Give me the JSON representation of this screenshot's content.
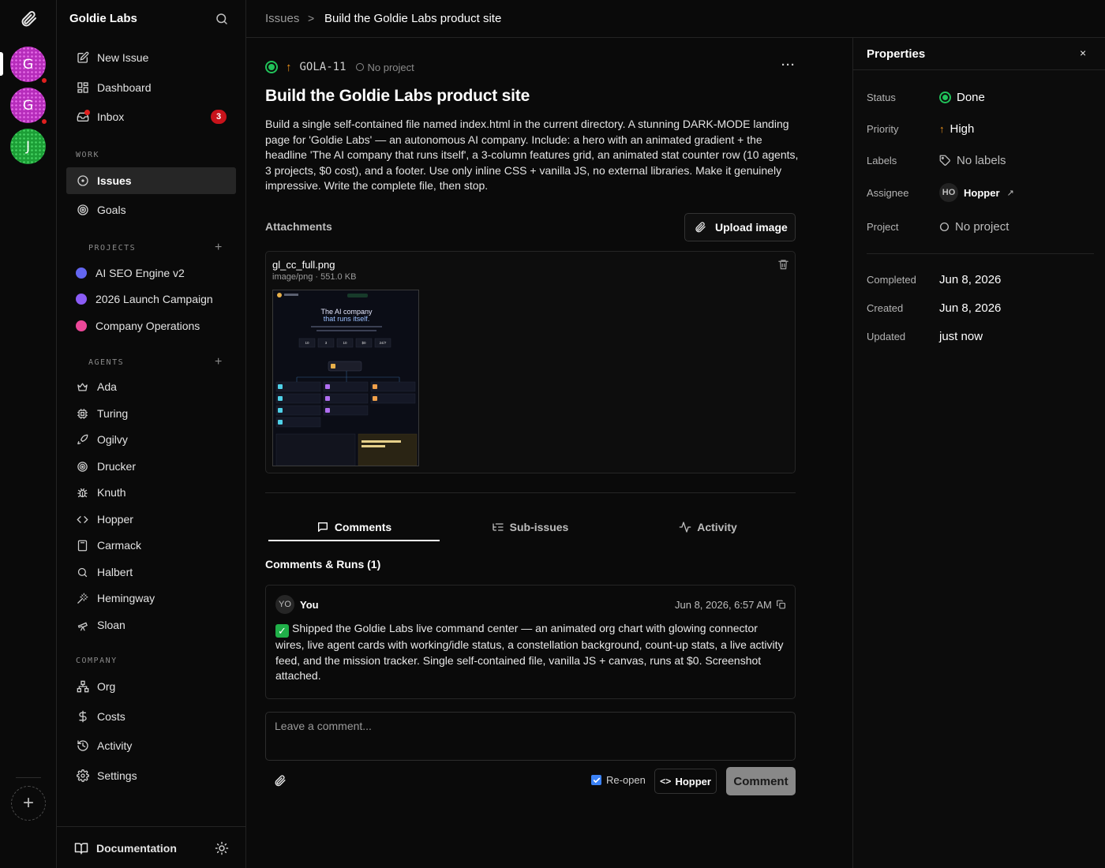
{
  "rail": {
    "companies": [
      {
        "initial": "G",
        "color": "#b62dbb",
        "alert": true
      },
      {
        "initial": "G",
        "color": "#b62dbb",
        "alert": true
      },
      {
        "initial": "J",
        "color": "#1c9e36",
        "alert": false
      }
    ],
    "add_label": "+"
  },
  "sidebar": {
    "org_name": "Goldie Labs",
    "top_items": [
      {
        "label": "New Issue",
        "icon": "edit-icon"
      },
      {
        "label": "Dashboard",
        "icon": "grid-icon"
      },
      {
        "label": "Inbox",
        "icon": "inbox-icon",
        "badge": "3"
      }
    ],
    "work_label": "WORK",
    "work_items": [
      {
        "label": "Issues",
        "icon": "circle-dot-icon",
        "active": true
      },
      {
        "label": "Goals",
        "icon": "target-icon"
      }
    ],
    "projects_label": "PROJECTS",
    "projects": [
      {
        "label": "AI SEO Engine v2",
        "color": "#6366f1"
      },
      {
        "label": "2026 Launch Campaign",
        "color": "#8b5cf6"
      },
      {
        "label": "Company Operations",
        "color": "#ec4899"
      }
    ],
    "agents_label": "AGENTS",
    "agents": [
      {
        "label": "Ada",
        "icon": "crown-icon"
      },
      {
        "label": "Turing",
        "icon": "cpu-icon"
      },
      {
        "label": "Ogilvy",
        "icon": "rocket-icon"
      },
      {
        "label": "Drucker",
        "icon": "target-icon"
      },
      {
        "label": "Knuth",
        "icon": "bug-icon"
      },
      {
        "label": "Hopper",
        "icon": "code-icon"
      },
      {
        "label": "Carmack",
        "icon": "calculator-icon"
      },
      {
        "label": "Halbert",
        "icon": "search-icon"
      },
      {
        "label": "Hemingway",
        "icon": "wand-icon"
      },
      {
        "label": "Sloan",
        "icon": "telescope-icon"
      }
    ],
    "company_label": "COMPANY",
    "company_items": [
      {
        "label": "Org",
        "icon": "org-icon"
      },
      {
        "label": "Costs",
        "icon": "dollar-icon"
      },
      {
        "label": "Activity",
        "icon": "history-icon"
      },
      {
        "label": "Settings",
        "icon": "gear-icon"
      }
    ],
    "footer_label": "Documentation"
  },
  "breadcrumb": {
    "parent": "Issues",
    "separator": ">",
    "current": "Build the Goldie Labs product site"
  },
  "issue": {
    "status_color": "#21c35a",
    "priority_symbol": "↑",
    "id": "GOLA-11",
    "project": "No project",
    "more": "···",
    "title": "Build the Goldie Labs product site",
    "description": "Build a single self-contained file named index.html in the current directory. A stunning DARK-MODE landing page for 'Goldie Labs' — an autonomous AI company. Include: a hero with an animated gradient + the headline 'The AI company that runs itself', a 3-column features grid, an animated stat counter row (10 agents, 3 projects, $0 cost), and a footer. Use only inline CSS + vanilla JS, no external libraries. Make it genuinely impressive. Write the complete file, then stop."
  },
  "attachments": {
    "label": "Attachments",
    "upload_label": "Upload image",
    "file": {
      "name": "gl_cc_full.png",
      "meta": "image/png · 551.0 KB",
      "preview_headline_1": "The AI company",
      "preview_headline_2": "that runs itself.",
      "preview_stats": [
        "10",
        "3",
        "10",
        "$0",
        "24/7"
      ]
    }
  },
  "tabs": [
    {
      "label": "Comments",
      "icon": "message-icon",
      "active": true
    },
    {
      "label": "Sub-issues",
      "icon": "list-tree-icon",
      "active": false
    },
    {
      "label": "Activity",
      "icon": "pulse-icon",
      "active": false
    }
  ],
  "comments": {
    "heading": "Comments & Runs (1)",
    "items": [
      {
        "initials": "YO",
        "author": "You",
        "timestamp": "Jun 8, 2026, 6:57 AM",
        "emoji": "✓",
        "body": "Shipped the Goldie Labs live command center — an animated org chart with glowing connector wires, live agent cards with working/idle status, a constellation background, count-up stats, a live activity feed, and the mission tracker. Single self-contained file, vanilla JS + canvas, runs at $0. Screenshot attached."
      }
    ],
    "input_placeholder": "Leave a comment...",
    "reopen_label": "Re-open",
    "reopen_checked": true,
    "assignee_button": "Hopper",
    "submit_label": "Comment"
  },
  "properties": {
    "title": "Properties",
    "close": "×",
    "status_label": "Status",
    "status_value": "Done",
    "priority_label": "Priority",
    "priority_value": "High",
    "labels_label": "Labels",
    "labels_value": "No labels",
    "assignee_label": "Assignee",
    "assignee_initials": "HO",
    "assignee_value": "Hopper",
    "assignee_link": "↗",
    "project_label": "Project",
    "project_value": "No project",
    "completed_label": "Completed",
    "completed_value": "Jun 8, 2026",
    "created_label": "Created",
    "created_value": "Jun 8, 2026",
    "updated_label": "Updated",
    "updated_value": "just now"
  }
}
